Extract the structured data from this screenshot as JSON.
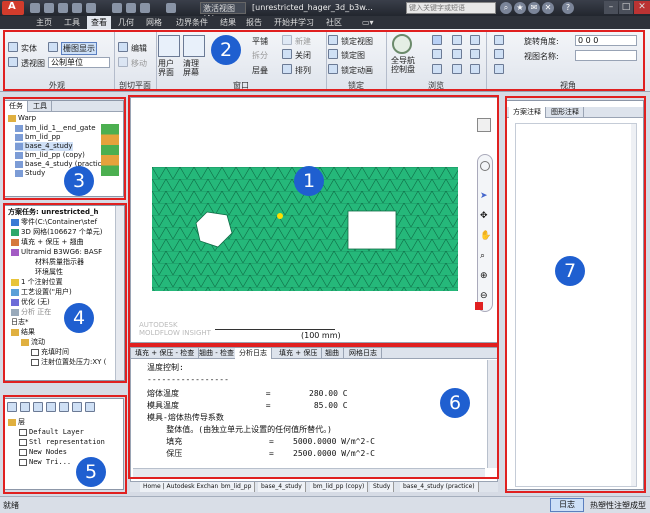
{
  "titlebar": {
    "view_combo": "激活视图(A)",
    "doc_title": "[unrestricted_hager_3d_b3w...",
    "search_placeholder": "键入关键字或短语"
  },
  "menu_tabs": [
    "主页",
    "工具",
    "查看",
    "几何",
    "网格",
    "边界条件",
    "结果",
    "报告",
    "开始并学习",
    "社区"
  ],
  "ribbon": {
    "group1": {
      "title": "外观",
      "solid": "实体",
      "perspective": "透视图",
      "mesh_display": "栅图显示",
      "units": "公制单位"
    },
    "group2": {
      "title": "剖切平面",
      "edit": "编辑",
      "move": "移动"
    },
    "group3": {
      "title": "窗口",
      "user_interface": "用户界面",
      "clear_screen": "清理屏幕",
      "tile": "平铺",
      "split": "拆分",
      "layer": "层叠",
      "new": "新建",
      "close": "关闭",
      "arrange": "排列"
    },
    "group4": {
      "title": "锁定",
      "lock_view": "锁定视图",
      "lock_plot": "锁定图",
      "lock_anim": "锁定动画"
    },
    "group5": {
      "title": "浏览",
      "fullnav": "全导航控制盘"
    },
    "group6": {
      "title": "视角",
      "rotation_label": "旋转角度:",
      "rotation_value": "0 0 0",
      "view_name_label": "视图名称:"
    }
  },
  "tasks_panel": {
    "tabs": [
      "任务",
      "工具"
    ],
    "root": "Warp",
    "items": [
      "bm_lid_1__end_gate",
      "bm_lid_pp",
      "base_4_study",
      "bm_lid_pp (copy)",
      "base_4_study (practice)",
      "Study"
    ]
  },
  "study_panel": {
    "lines": [
      "方案任务: unrestricted_h",
      "零件(C:\\Container\\stef",
      "3D 网格(106627 个单元)",
      "填充 + 保压 + 翘曲",
      "Ultramid B3WG6: BASF",
      "材料质量指示器",
      "环境属性",
      "1 个注射位置",
      "工艺设置(\"用户)",
      "优化 (无)",
      "分析 正在",
      "日志*",
      "结果",
      "流动",
      "充填时间",
      "注射位置处压力:XY ("
    ]
  },
  "layers_panel": {
    "root": "层",
    "items": [
      "Default Layer",
      "Stl representation",
      "New Nodes",
      "New Tri..."
    ]
  },
  "viewport": {
    "scale_label": "(100 mm)",
    "watermark_line1": "AUTODESK",
    "watermark_line2": "MOLDFLOW INSIGHT"
  },
  "log_panel": {
    "tabs": [
      "填充 + 保压 - 检查",
      "翘曲 - 检查",
      "分析日志",
      "填充 + 保压",
      "翘曲",
      "网格日志"
    ],
    "lines": [
      "温度控制:",
      "-----------------",
      "熔体温度                  =        280.00 C",
      "模具温度                  =         85.00 C",
      "模具-熔体热传导系数",
      "    整体值。(由独立单元上设置的任何值所替代。)",
      "    填充                  =    5000.0000 W/m^2-C",
      "    保压                  =    2500.0000 W/m^2-C"
    ],
    "doc_tabs": [
      "Home | Autodesk Exchange",
      "bm_lid_pp",
      "base_4_study",
      "bm_lid_pp (copy)",
      "Study",
      "base_4_study (practice)"
    ]
  },
  "right_panel": {
    "tabs": [
      "方案注释",
      "图形注释"
    ]
  },
  "status": {
    "left": "就绪",
    "log_button": "日志",
    "right": "热塑性注塑成型"
  },
  "badges": [
    "1",
    "2",
    "3",
    "4",
    "5",
    "6",
    "7"
  ],
  "colors": {
    "mesh": "#25b87a",
    "highlight": "#e02020",
    "badge": "#1f5fd0"
  }
}
